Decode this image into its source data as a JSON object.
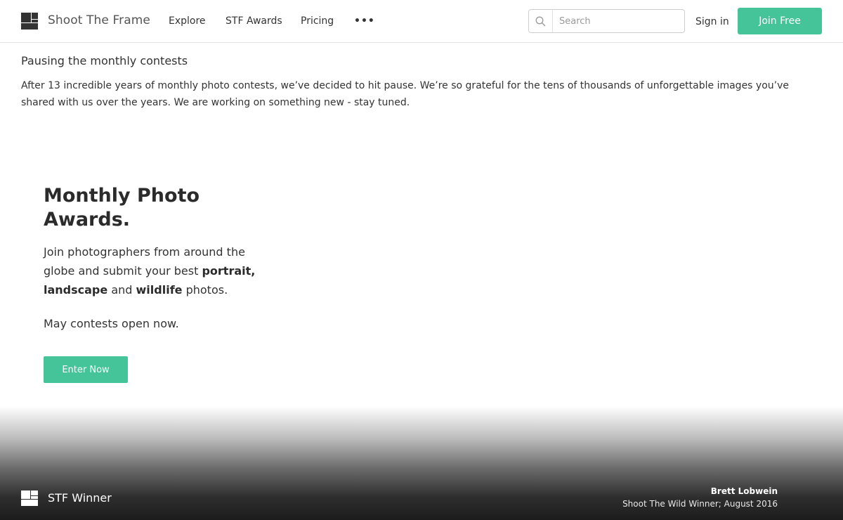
{
  "header": {
    "brand": "Shoot The Frame",
    "nav": [
      {
        "label": "Explore"
      },
      {
        "label": "STF Awards"
      },
      {
        "label": "Pricing"
      }
    ],
    "more_label": "•••",
    "search_placeholder": "Search",
    "search_value": "",
    "signin_label": "Sign in",
    "join_label": "Join Free"
  },
  "notice": {
    "title": "Pausing the monthly contests",
    "body": "After 13 incredible years of monthly photo contests, we’ve decided to hit pause. We’re so grateful for the tens of thousands of unforgettable images you’ve shared with us over the years. We are working on something new - stay tuned."
  },
  "hero": {
    "title": "Monthly Photo Awards.",
    "text_part1": "Join photographers from around the globe and submit your best ",
    "bold1": "portrait,",
    "space1": " ",
    "bold2": "landscape",
    "text_part2": " and ",
    "bold3": "wildlife",
    "text_part3": " photos.",
    "open_text": "May contests open now.",
    "cta_label": "Enter Now"
  },
  "footer": {
    "winner_label": "STF Winner",
    "credit_name": "Brett Lobwein",
    "credit_sub": "Shoot The Wild Winner; August 2016"
  },
  "colors": {
    "accent": "#46c499",
    "text": "#333333",
    "header_border": "#e4e4e4"
  },
  "icons": {
    "logo": "stf-logo-icon",
    "search": "search-icon",
    "more": "more-dots-icon"
  }
}
